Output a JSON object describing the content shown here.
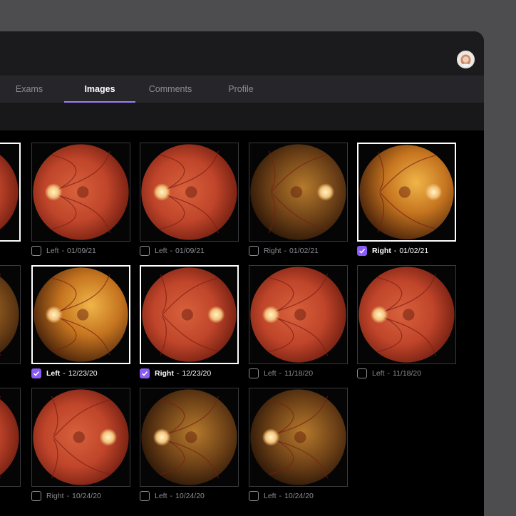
{
  "tabs": [
    {
      "label": "Exams",
      "active": false
    },
    {
      "label": "Images",
      "active": true
    },
    {
      "label": "Comments",
      "active": false
    },
    {
      "label": "Profile",
      "active": false
    }
  ],
  "user": {
    "avatar_icon": "user-avatar"
  },
  "colors": {
    "accent": "#8a5cf6",
    "tab_underline": "#9d7df3"
  },
  "caption_separator": "-",
  "images": [
    {
      "eye": "",
      "date": "",
      "selected": true,
      "tone": "red"
    },
    {
      "eye": "Left",
      "date": "01/09/21",
      "selected": false,
      "tone": "red"
    },
    {
      "eye": "Left",
      "date": "01/09/21",
      "selected": false,
      "tone": "red"
    },
    {
      "eye": "Right",
      "date": "01/02/21",
      "selected": false,
      "tone": "dark"
    },
    {
      "eye": "Right",
      "date": "01/02/21",
      "selected": true,
      "tone": "gold"
    },
    {
      "eye": "",
      "date": "",
      "selected": false,
      "tone": "dark"
    },
    {
      "eye": "Left",
      "date": "12/23/20",
      "selected": true,
      "tone": "gold"
    },
    {
      "eye": "Right",
      "date": "12/23/20",
      "selected": true,
      "tone": "red"
    },
    {
      "eye": "Left",
      "date": "11/18/20",
      "selected": false,
      "tone": "red"
    },
    {
      "eye": "Left",
      "date": "11/18/20",
      "selected": false,
      "tone": "red"
    },
    {
      "eye": "",
      "date": "",
      "selected": false,
      "tone": "red"
    },
    {
      "eye": "Right",
      "date": "10/24/20",
      "selected": false,
      "tone": "red"
    },
    {
      "eye": "Left",
      "date": "10/24/20",
      "selected": false,
      "tone": "dark"
    },
    {
      "eye": "Left",
      "date": "10/24/20",
      "selected": false,
      "tone": "dark"
    }
  ]
}
